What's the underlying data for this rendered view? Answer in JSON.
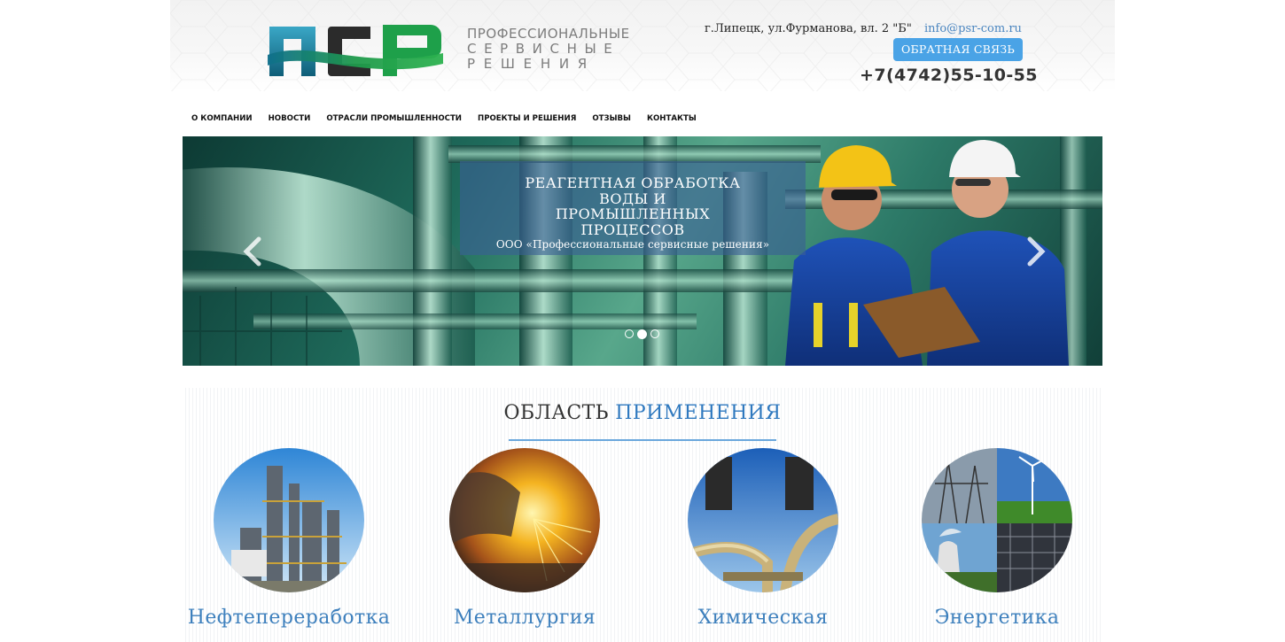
{
  "header": {
    "logo_alt": "ПСР",
    "logo_tagline": [
      "ПРОФЕССИОНАЛЬНЫЕ",
      "СЕРВИСНЫЕ",
      "РЕШЕНИЯ"
    ],
    "address": "г.Липецк, ул.Фурманова, вл. 2 \"Б\"",
    "email": "info@psr-com.ru",
    "feedback_button": "ОБРАТНАЯ СВЯЗЬ",
    "phone": "+7(4742)55-10-55"
  },
  "nav": {
    "items": [
      "О КОМПАНИИ",
      "НОВОСТИ",
      "ОТРАСЛИ ПРОМЫШЛЕННОСТИ",
      "ПРОЕКТЫ И РЕШЕНИЯ",
      "ОТЗЫВЫ",
      "КОНТАКТЫ"
    ]
  },
  "slider": {
    "title": "РЕАГЕНТНАЯ ОБРАБОТКА ВОДЫ И ПРОМЫШЛЕННЫХ ПРОЦЕССОВ",
    "subtitle": "ООО «Профессиональные сервисные решения»",
    "prev_icon": "chevron-left-icon",
    "next_icon": "chevron-right-icon",
    "slide_count": 3,
    "active_slide": 2
  },
  "applications": {
    "title_part1": "ОБЛАСТЬ",
    "title_part2": "ПРИМЕНЕНИЯ",
    "items": [
      "Нефтепереработка",
      "Металлургия",
      "Химическая",
      "Энергетика"
    ]
  },
  "colors": {
    "accent_blue": "#4aa3e6",
    "link_blue": "#4b86c0",
    "heading_blue": "#2f79bf",
    "logo_teal": "#1f7f9a",
    "logo_green": "#1ea04a"
  }
}
